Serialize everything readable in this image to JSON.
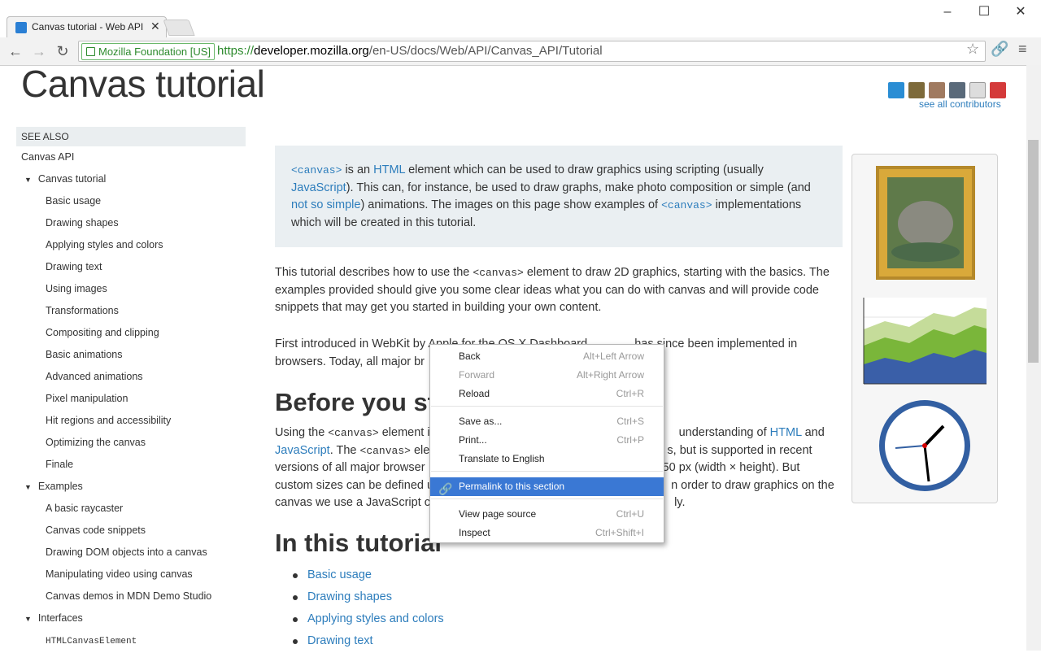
{
  "browser": {
    "tab_title": "Canvas tutorial - Web API",
    "security_label": "Mozilla Foundation [US]",
    "url_scheme": "https://",
    "url_host": "developer.mozilla.org",
    "url_path": "/en-US/docs/Web/API/Canvas_API/Tutorial"
  },
  "page": {
    "title": "Canvas tutorial",
    "contributors_link": "see all contributors"
  },
  "sidebar": {
    "see_also": "SEE ALSO",
    "items": [
      {
        "label": "Canvas API",
        "level": 0
      },
      {
        "label": "Canvas tutorial",
        "level": 1,
        "expanded": true
      },
      {
        "label": "Basic usage",
        "level": 2
      },
      {
        "label": "Drawing shapes",
        "level": 2
      },
      {
        "label": "Applying styles and colors",
        "level": 2
      },
      {
        "label": "Drawing text",
        "level": 2
      },
      {
        "label": "Using images",
        "level": 2
      },
      {
        "label": "Transformations",
        "level": 2
      },
      {
        "label": "Compositing and clipping",
        "level": 2
      },
      {
        "label": "Basic animations",
        "level": 2
      },
      {
        "label": "Advanced animations",
        "level": 2
      },
      {
        "label": "Pixel manipulation",
        "level": 2
      },
      {
        "label": "Hit regions and accessibility",
        "level": 2
      },
      {
        "label": "Optimizing the canvas",
        "level": 2
      },
      {
        "label": "Finale",
        "level": 2
      },
      {
        "label": "Examples",
        "level": 1,
        "expanded": true
      },
      {
        "label": "A basic raycaster",
        "level": 2
      },
      {
        "label": "Canvas code snippets",
        "level": 2
      },
      {
        "label": "Drawing DOM objects into a canvas",
        "level": 2
      },
      {
        "label": "Manipulating video using canvas",
        "level": 2
      },
      {
        "label": "Canvas demos in MDN Demo Studio",
        "level": 2
      },
      {
        "label": "Interfaces",
        "level": 1,
        "expanded": true
      },
      {
        "label": "HTMLCanvasElement",
        "level": 2,
        "mono": true
      }
    ]
  },
  "callout": {
    "code1": "<canvas>",
    "t1": " is an ",
    "link_html": "HTML",
    "t2": " element which can be used to draw graphics using scripting (usually ",
    "link_js": "JavaScript",
    "t3": "). This can, for instance, be used to draw graphs, make photo composition or simple (and ",
    "link_notsimple": "not so simple",
    "t4": ") animations. The images on this page show examples of ",
    "code2": "<canvas>",
    "t5": " implementations which will be created in this tutorial."
  },
  "intro": {
    "p1a": "This tutorial describes how to use the ",
    "p1code": "<canvas>",
    "p1b": " element to draw 2D graphics, starting with the basics. The examples provided should give you some clear ideas what you can do with canvas and will provide code snippets that may get you started in building your own content.",
    "p2a": "First introduced in WebKit by ",
    "p2b": "Apple for the OS X Dashboard, ",
    "p2c": " has since been implemented in browsers. Today, all major br"
  },
  "before": {
    "heading": "Before you sta",
    "l1a": "Using the ",
    "l1code": "<canvas>",
    "l1b": " element i",
    "l1c": "understanding of ",
    "l1html": "HTML",
    "l1d": " and",
    "l2js": "JavaScript",
    "l2a": ". The ",
    "l2code": "<canvas>",
    "l2b": " elem",
    "l2c": "s, but is supported in recent",
    "l3a": "versions of all major browser",
    "l3b": "50 px (width × height). But",
    "l4a": "custom sizes can be defined u",
    "l4b": "n order to draw graphics on the",
    "l5a": "canvas we use a JavaScript co",
    "l5b": "ly."
  },
  "tutorial": {
    "heading": "In this tutorial",
    "items": [
      "Basic usage",
      "Drawing shapes",
      "Applying styles and colors",
      "Drawing text"
    ]
  },
  "context_menu": {
    "items": [
      {
        "label": "Back",
        "shortcut": "Alt+Left Arrow",
        "disabled": false
      },
      {
        "label": "Forward",
        "shortcut": "Alt+Right Arrow",
        "disabled": true
      },
      {
        "label": "Reload",
        "shortcut": "Ctrl+R",
        "disabled": false
      },
      {
        "label": "Save as...",
        "shortcut": "Ctrl+S",
        "disabled": false
      },
      {
        "label": "Print...",
        "shortcut": "Ctrl+P",
        "disabled": false
      },
      {
        "label": "Translate to English",
        "shortcut": "",
        "disabled": false
      },
      {
        "label": "Permalink to this section",
        "shortcut": "",
        "highlighted": true
      },
      {
        "label": "View page source",
        "shortcut": "Ctrl+U",
        "disabled": false
      },
      {
        "label": "Inspect",
        "shortcut": "Ctrl+Shift+I",
        "disabled": false
      }
    ]
  },
  "colors": {
    "link": "#2d7dbc",
    "highlight": "#3a78d4",
    "secure_green": "#2d8a2d"
  }
}
